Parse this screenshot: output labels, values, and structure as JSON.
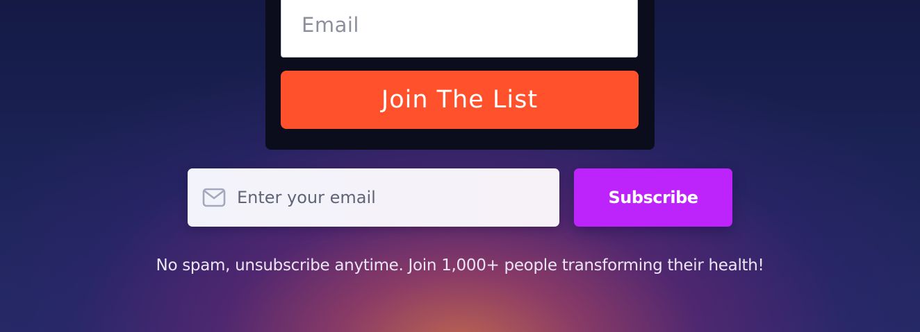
{
  "signup_card": {
    "email_placeholder": "Email",
    "join_button_label": "Join The List",
    "accent_color": "#ff522c",
    "background_color": "#0b0d1c"
  },
  "subscribe_form": {
    "email_placeholder": "Enter your email",
    "email_value": "",
    "email_icon": "mail-icon",
    "subscribe_button_label": "Subscribe",
    "button_color": "#bd24fb"
  },
  "fine_print": "No spam, unsubscribe anytime. Join 1,000+ people transforming their health!"
}
